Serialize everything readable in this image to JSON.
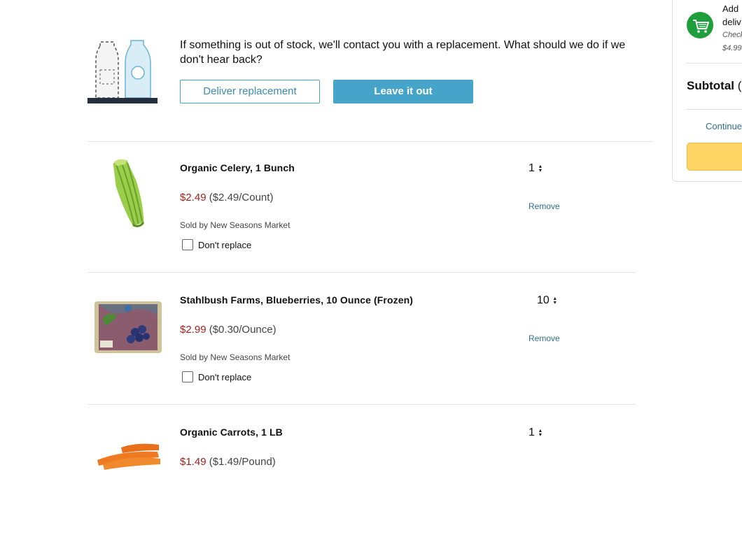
{
  "banner": {
    "message": "If something is out of stock, we'll contact you with a replacement. What should we do if we don't hear back?",
    "deliver_replacement_label": "Deliver replacement",
    "leave_it_out_label": "Leave it out"
  },
  "items": [
    {
      "title": "Organic Celery, 1 Bunch",
      "price": "$2.49",
      "unit_price": "($2.49/Count)",
      "sold_by": "Sold by New Seasons Market",
      "dont_replace_label": "Don't replace",
      "quantity": "1",
      "remove_label": "Remove"
    },
    {
      "title": "Stahlbush Farms, Blueberries, 10 Ounce (Frozen)",
      "price": "$2.99",
      "unit_price": "($0.30/Ounce)",
      "sold_by": "Sold by New Seasons Market",
      "dont_replace_label": "Don't replace",
      "quantity": "10",
      "remove_label": "Remove"
    },
    {
      "title": "Organic Carrots, 1 LB",
      "price": "$1.49",
      "unit_price": "($1.49/Pound)",
      "quantity": "1"
    }
  ],
  "sidebar": {
    "add_line1": "Add",
    "add_line2": "deliv",
    "check_line1": "Check",
    "check_line2": "$4.99",
    "subtotal_label": "Subtotal",
    "subtotal_paren": "(",
    "continue_label": "Continue",
    "icon": "shopping-cart-icon"
  },
  "colors": {
    "accent_blue": "#46a3c9",
    "price_red": "#a5221c",
    "link_blue": "#2e6f8e",
    "cart_green": "#1f9e3c",
    "checkout_yellow": "#fcd565"
  }
}
